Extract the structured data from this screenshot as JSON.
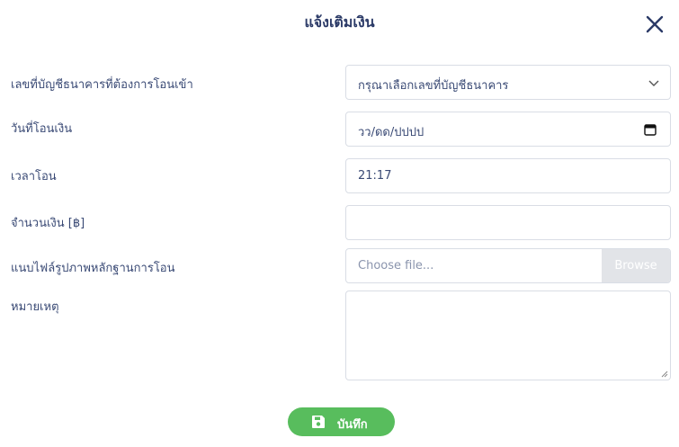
{
  "modal": {
    "title": "แจ้งเติมเงิน",
    "close_icon": "close-icon"
  },
  "form": {
    "bank_account": {
      "label": "เลขที่บัญชีธนาคารที่ต้องการโอนเข้า",
      "selected_value": "กรุณาเลือกเลขที่บัญชีธนาคาร"
    },
    "transfer_date": {
      "label": "วันที่โอนเงิน",
      "value": "วว/ดด/ปปปป"
    },
    "transfer_time": {
      "label": "เวลาโอน",
      "value": "21:17"
    },
    "amount": {
      "label": "จำนวนเงิน [฿]",
      "value": ""
    },
    "slip_file": {
      "label": "แนบไฟล์รูปภาพหลักฐานการโอน",
      "placeholder": "Choose file...",
      "browse_label": "Browse"
    },
    "note": {
      "label": "หมายเหตุ",
      "value": ""
    }
  },
  "actions": {
    "save_label": "บันทึก",
    "save_color": "#58bd5d"
  },
  "colors": {
    "text": "#2b3a67",
    "border": "#d9dde5"
  }
}
